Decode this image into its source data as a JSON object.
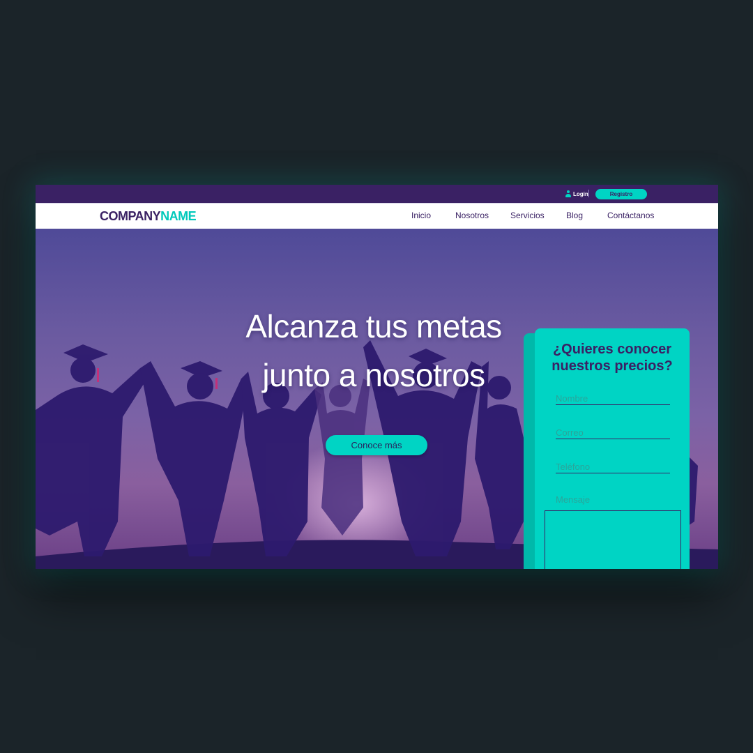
{
  "topbar": {
    "login_label": "Login",
    "register_label": "Registro"
  },
  "brand": {
    "name_part1": "COMPANY",
    "name_part2": "NAME"
  },
  "nav": {
    "items": [
      {
        "label": "Inicio"
      },
      {
        "label": "Nosotros"
      },
      {
        "label": "Servicios"
      },
      {
        "label": "Blog"
      },
      {
        "label": "Contáctanos"
      }
    ]
  },
  "hero": {
    "title_line1": "Alcanza tus metas",
    "title_line2": "junto a nosotros",
    "cta_label": "Conoce más"
  },
  "form": {
    "title_line1": "¿Quieres conocer",
    "title_line2": "nuestros precios?",
    "name_placeholder": "Nombre",
    "email_placeholder": "Correo",
    "phone_placeholder": "Teléfono",
    "message_label": "Mensaje"
  },
  "colors": {
    "brand_purple": "#3a2164",
    "accent_teal": "#00d4c4",
    "page_background": "#1b2429"
  },
  "icons": {
    "login": "user-icon"
  }
}
